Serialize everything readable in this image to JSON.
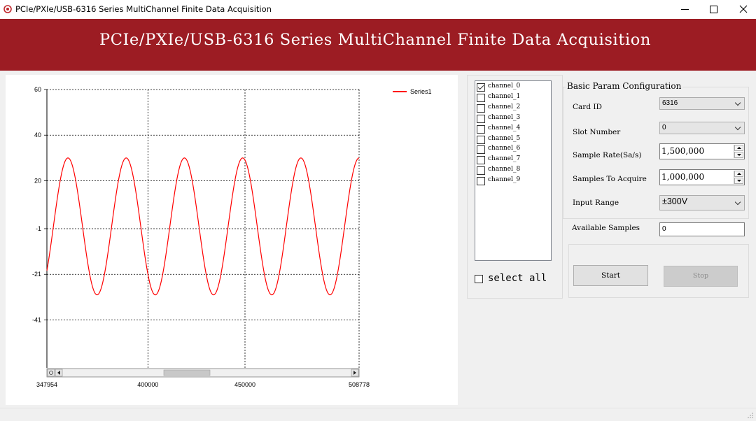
{
  "window": {
    "title": "PCIe/PXIe/USB-6316 Series MultiChannel Finite Data Acquisition",
    "icon": "app-logo-icon",
    "controls": [
      "minimize-icon",
      "maximize-icon",
      "close-icon"
    ]
  },
  "banner": {
    "title": "PCIe/PXIe/USB-6316 Series MultiChannel Finite Data Acquisition",
    "color": "#9c1c23"
  },
  "chart_data": {
    "type": "line",
    "title": "",
    "xlabel": "",
    "ylabel": "",
    "x_ticks": [
      "347954",
      "400000",
      "450000",
      "508778"
    ],
    "x_tick_values": [
      347954,
      400000,
      450000,
      508778
    ],
    "y_ticks": [
      "60",
      "40",
      "20",
      "-1",
      "-21",
      "-41"
    ],
    "xlim": [
      347954,
      508778
    ],
    "ylim": [
      -62,
      60
    ],
    "grid": true,
    "legend": "top-right",
    "series": [
      {
        "name": "Series1",
        "color": "#ff0000",
        "shape": "sine",
        "amplitude": 30,
        "offset": 0,
        "period": 30000,
        "peak_x": 358800
      }
    ],
    "scrollbar": true
  },
  "channels": {
    "items": [
      {
        "label": "channel_0",
        "checked": true
      },
      {
        "label": "channel_1",
        "checked": false
      },
      {
        "label": "channel_2",
        "checked": false
      },
      {
        "label": "channel_3",
        "checked": false
      },
      {
        "label": "channel_4",
        "checked": false
      },
      {
        "label": "channel_5",
        "checked": false
      },
      {
        "label": "channel_6",
        "checked": false
      },
      {
        "label": "channel_7",
        "checked": false
      },
      {
        "label": "channel_8",
        "checked": false
      },
      {
        "label": "channel_9",
        "checked": false
      }
    ],
    "select_all_label": "select all",
    "select_all_checked": false
  },
  "params": {
    "group_title": "Basic Param Configuration",
    "card_id_label": "Card ID",
    "card_id_value": "6316",
    "slot_number_label": "Slot Number",
    "slot_number_value": "0",
    "sample_rate_label": "Sample Rate(Sa/s)",
    "sample_rate_value": "1,500,000",
    "samples_to_acquire_label": "Samples To Acquire",
    "samples_to_acquire_value": "1,000,000",
    "input_range_label": "Input Range",
    "input_range_value": "±300V"
  },
  "available": {
    "label": "Available Samples",
    "value": "0"
  },
  "actions": {
    "start_label": "Start",
    "stop_label": "Stop"
  }
}
